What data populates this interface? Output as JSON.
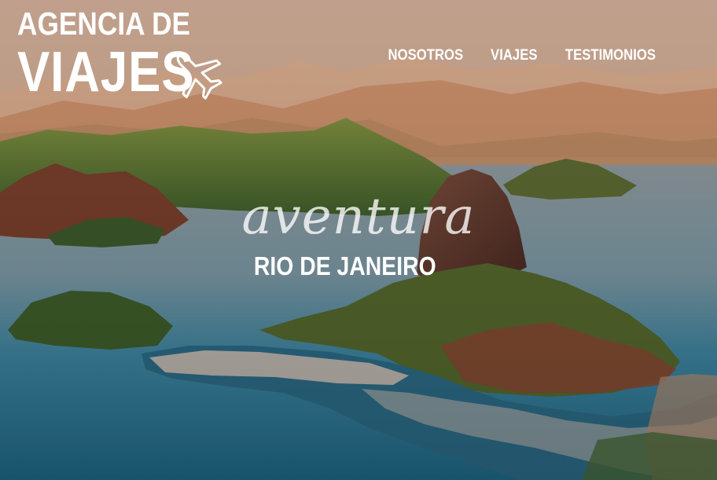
{
  "header": {
    "logo_line1": "AGENCIA DE",
    "logo_line2": "VIAJES",
    "logo_icon": "airplane-icon"
  },
  "nav": {
    "items": [
      {
        "label": "NOSOTROS"
      },
      {
        "label": "VIAJES"
      },
      {
        "label": "TESTIMONIOS"
      }
    ]
  },
  "hero": {
    "tagline": "aventura",
    "destination": "RIO DE JANEIRO"
  },
  "colors": {
    "text": "#ffffff",
    "sky": "#d7b49a",
    "sea": "#2f7f9c"
  }
}
